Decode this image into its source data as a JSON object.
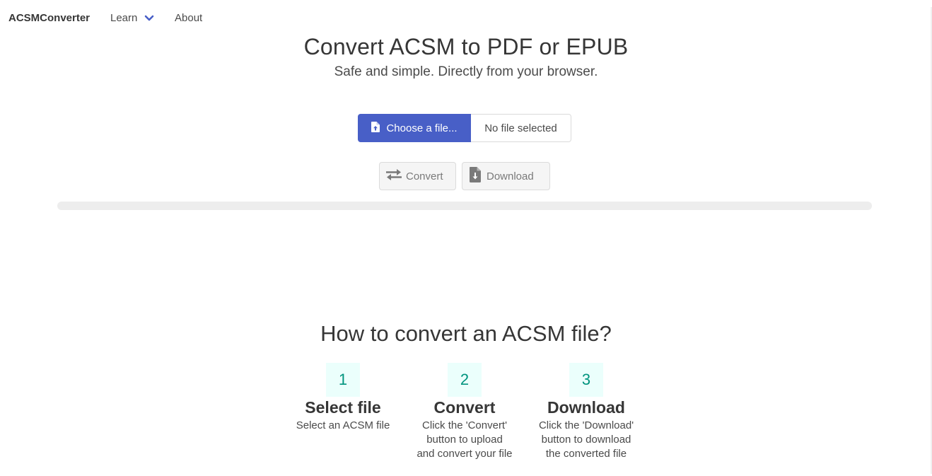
{
  "navbar": {
    "brand": "ACSMConverter",
    "learn_label": "Learn",
    "about_label": "About"
  },
  "hero": {
    "title": "Convert ACSM to PDF or EPUB",
    "subtitle": "Safe and simple. Directly from your browser."
  },
  "file_input": {
    "choose_label": "Choose a file...",
    "file_name": "No file selected"
  },
  "actions": {
    "convert_label": "Convert",
    "download_label": "Download"
  },
  "progress": {
    "value": 0
  },
  "howto": {
    "title": "How to convert an ACSM file?",
    "steps": [
      {
        "number": "1",
        "title": "Select file",
        "desc_lines": [
          "Select an ACSM file"
        ]
      },
      {
        "number": "2",
        "title": "Convert",
        "desc_lines": [
          "Click the 'Convert'",
          "button to upload",
          "and convert your file"
        ]
      },
      {
        "number": "3",
        "title": "Download",
        "desc_lines": [
          "Click the 'Download'",
          "button to download",
          "the converted file"
        ]
      }
    ]
  },
  "colors": {
    "primary": "#485fc7",
    "step_bg": "#ebfffc",
    "step_text": "#00947e",
    "progress_track": "#ededed",
    "disabled_button_bg": "#f5f5f5"
  },
  "icons": {
    "learn_dropdown": "chevron-down-icon",
    "choose_file": "file-upload-icon",
    "convert": "exchange-arrows-icon",
    "download": "file-download-icon"
  }
}
